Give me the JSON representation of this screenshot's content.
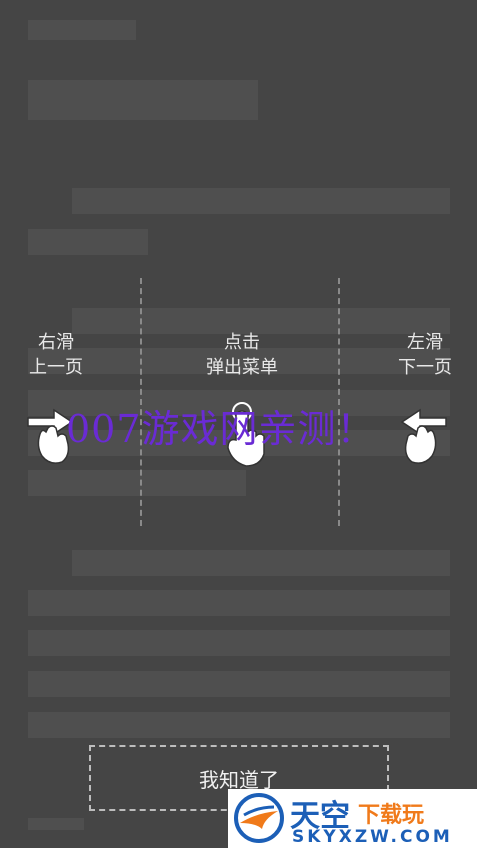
{
  "guide": {
    "left_zone": {
      "line1": "右滑",
      "line2": "上一页"
    },
    "center_zone": {
      "line1": "点击",
      "line2": "弹出菜单"
    },
    "right_zone": {
      "line1": "左滑",
      "line2": "下一页"
    }
  },
  "watermark": "007游戏网亲测！",
  "got_it_label": "我知道了",
  "logo": {
    "main": "天空",
    "sub": "下载玩",
    "url": "SKYXZW.COM"
  },
  "colors": {
    "overlay_bg": "#454545",
    "watermark": "#6a2bd4",
    "logo_blue": "#1c5fb7",
    "logo_orange": "#f07a1a"
  }
}
